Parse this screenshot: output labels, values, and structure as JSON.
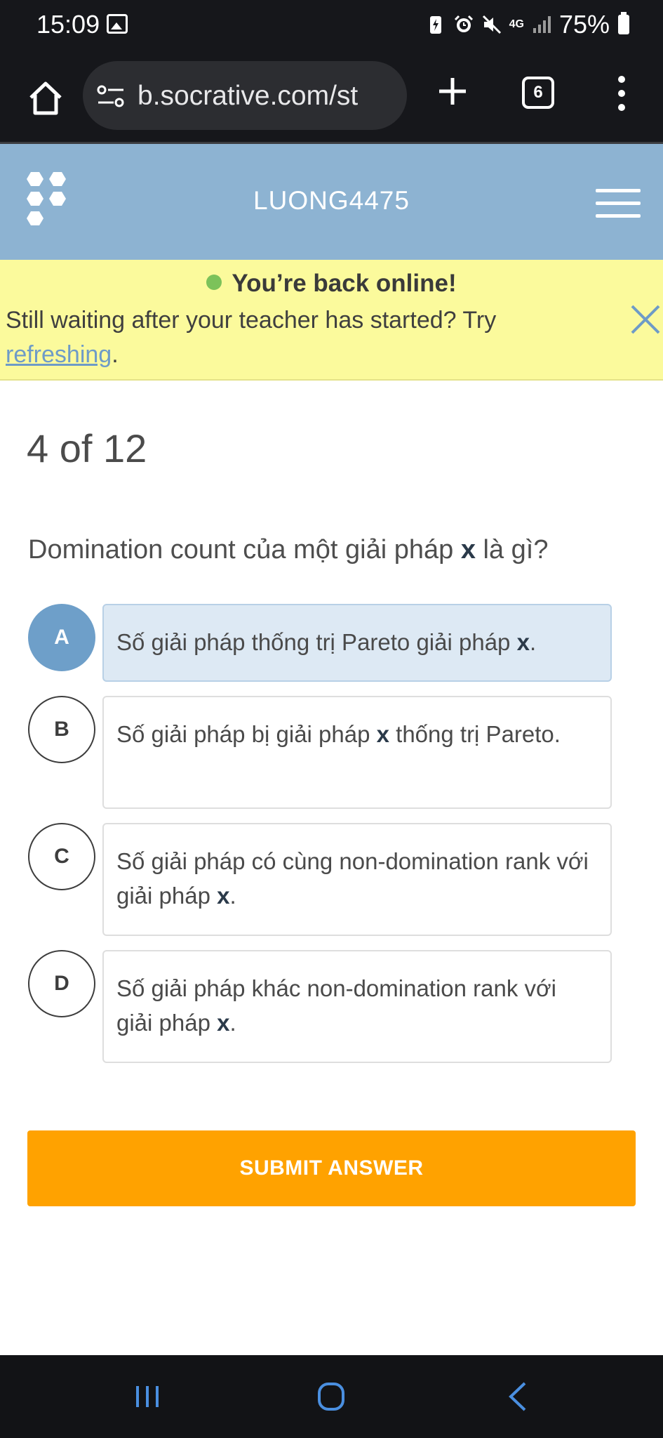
{
  "status_bar": {
    "time": "15:09",
    "network": "4G",
    "battery": "75%"
  },
  "browser": {
    "url": "b.socrative.com/st",
    "tab_count": "6"
  },
  "header": {
    "room_name": "LUONG4475"
  },
  "notice": {
    "title": "You’re back online!",
    "body_text": "Still waiting after your teacher has started? Try ",
    "link_text": "refreshing",
    "body_end": "."
  },
  "quiz": {
    "progress": "4 of 12",
    "question_prefix": "Domination count của một giải pháp ",
    "question_var": "x",
    "question_suffix": " là gì?",
    "selected": "A",
    "options": [
      {
        "letter": "A",
        "text_before": "Số giải pháp thống trị Pareto giải pháp ",
        "var": "x",
        "text_after": "."
      },
      {
        "letter": "B",
        "text_before": "Số giải pháp bị giải pháp ",
        "var": "x",
        "text_after": " thống trị Pareto."
      },
      {
        "letter": "C",
        "text_before": "Số giải pháp có cùng non-domination rank với giải pháp ",
        "var": "x",
        "text_after": "."
      },
      {
        "letter": "D",
        "text_before": "Số giải pháp khác non-domination rank với giải pháp ",
        "var": "x",
        "text_after": "."
      }
    ],
    "submit_label": "SUBMIT ANSWER"
  },
  "colors": {
    "header_bg": "#8db3d2",
    "notice_bg": "#fbfa9c",
    "selected_circle": "#6e9fc9",
    "selected_box": "#dde9f4",
    "submit_bg": "#ffa200",
    "online_dot": "#7cc25a"
  },
  "icons": [
    "image-icon",
    "battery-saver-icon",
    "alarm-icon",
    "mute-icon",
    "signal-icon",
    "home-icon",
    "site-settings-icon",
    "new-tab-icon",
    "tab-switcher-icon",
    "more-menu-icon",
    "socrative-logo",
    "hamburger-menu-icon",
    "close-icon",
    "recents-icon",
    "home-nav-icon",
    "back-icon"
  ]
}
